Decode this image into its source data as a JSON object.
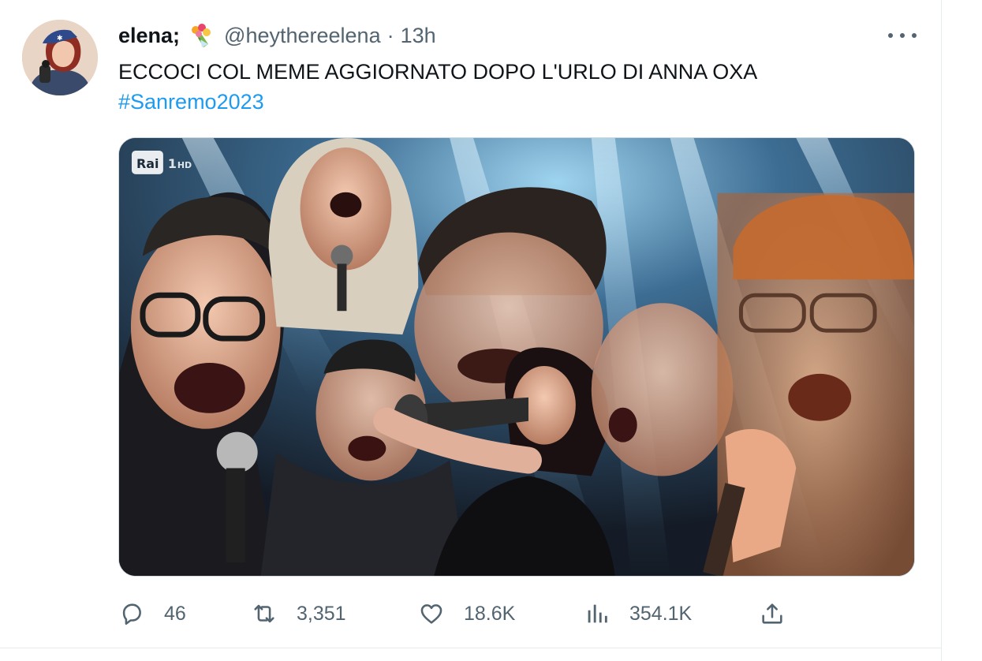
{
  "tweet": {
    "display_name": "elena;",
    "handle": "@heythereelena",
    "separator": "·",
    "time": "13h",
    "text": "ECCOCI COL MEME AGGIORNATO DOPO L'URLO DI ANNA OXA",
    "hashtag": "#Sanremo2023",
    "media_watermark": "Rai 1 HD"
  },
  "actions": {
    "replies": "46",
    "retweets": "3,351",
    "likes": "18.6K",
    "views": "354.1K"
  },
  "icons": {
    "name_emoji": "bouquet-icon",
    "more": "more-options-icon",
    "reply": "reply-icon",
    "retweet": "retweet-icon",
    "like": "heart-icon",
    "views": "views-chart-icon",
    "share": "share-icon"
  },
  "colors": {
    "text": "#0f1419",
    "secondary": "#536471",
    "link": "#1d9bf0",
    "border": "#cfd9de"
  }
}
